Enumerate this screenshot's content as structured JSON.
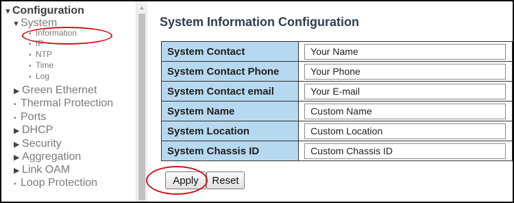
{
  "sidebar": {
    "items": [
      {
        "label": "Configuration",
        "type": "expanded",
        "level": 0
      },
      {
        "label": "System",
        "type": "expanded",
        "level": 1
      },
      {
        "label": "Information",
        "type": "leaf",
        "level": 2
      },
      {
        "label": "IP",
        "type": "leaf",
        "level": 2
      },
      {
        "label": "NTP",
        "type": "leaf",
        "level": 2
      },
      {
        "label": "Time",
        "type": "leaf",
        "level": 2
      },
      {
        "label": "Log",
        "type": "leaf",
        "level": 2
      },
      {
        "label": "Green Ethernet",
        "type": "collapsed",
        "level": 1
      },
      {
        "label": "Thermal Protection",
        "type": "leaf",
        "level": 1
      },
      {
        "label": "Ports",
        "type": "leaf",
        "level": 1
      },
      {
        "label": "DHCP",
        "type": "collapsed",
        "level": 1
      },
      {
        "label": "Security",
        "type": "collapsed",
        "level": 1
      },
      {
        "label": "Aggregation",
        "type": "collapsed",
        "level": 1
      },
      {
        "label": "Link OAM",
        "type": "collapsed",
        "level": 1
      },
      {
        "label": "Loop Protection",
        "type": "leaf",
        "level": 1
      }
    ]
  },
  "main": {
    "title": "System Information Configuration",
    "rows": [
      {
        "label": "System Contact",
        "value": "Your Name"
      },
      {
        "label": "System Contact Phone",
        "value": "Your Phone"
      },
      {
        "label": "System Contact email",
        "value": "Your E-mail"
      },
      {
        "label": "System Name",
        "value": "Custom Name"
      },
      {
        "label": "System Location",
        "value": "Custom Location"
      },
      {
        "label": "System Chassis ID",
        "value": "Custom Chassis ID"
      }
    ],
    "apply_label": "Apply",
    "reset_label": "Reset"
  },
  "colors": {
    "label_bg": "#b7d9ef",
    "title": "#2c3e50",
    "annotation": "#d4121a"
  }
}
